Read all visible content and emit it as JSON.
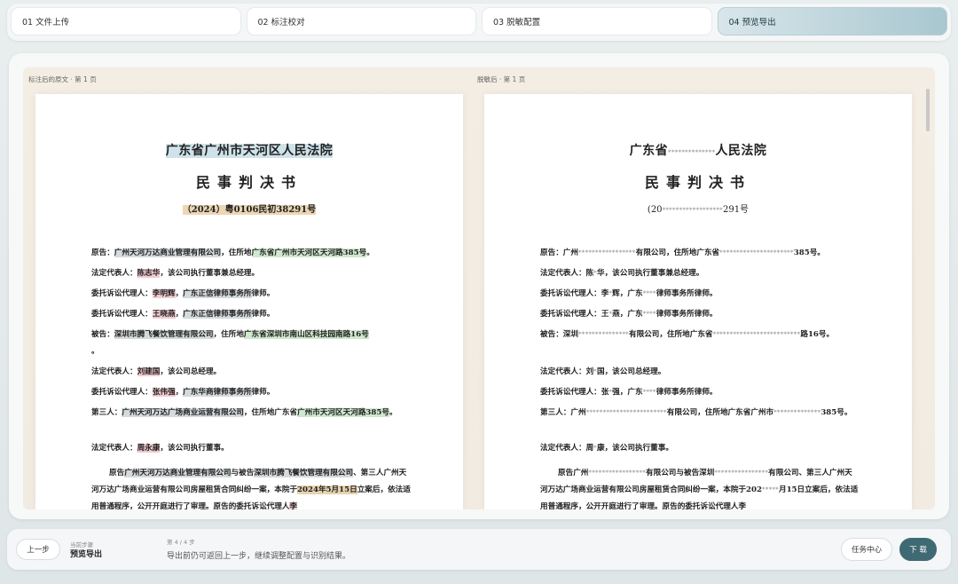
{
  "steps": [
    {
      "label": "01 文件上传"
    },
    {
      "label": "02 标注校对"
    },
    {
      "label": "03 脱敏配置"
    },
    {
      "label": "04 预览导出"
    }
  ],
  "left_pane": {
    "label": "标注后的原文 · 第 1 页",
    "court": "广东省广州市天河区人民法院",
    "doc_title": "民事判决书",
    "case_no": "（2024）粤0106民初38291号",
    "p1": {
      "a": "原告：",
      "org": "广州天河万达商业管理有限公司",
      "b": "，住所地",
      "addr": "广东省广州市天河区天河路385号",
      "c": "。"
    },
    "p2": {
      "a": "法定代表人：",
      "name": "陈志华",
      "b": "，该公司执行董事兼总经理。"
    },
    "p3": {
      "a": "委托诉讼代理人：",
      "name": "李明辉",
      "b": "，",
      "org": "广东正信律师事务所",
      "c": "律师。"
    },
    "p4": {
      "a": "委托诉讼代理人：",
      "name": "王晓燕",
      "b": "，",
      "org": "广东正信律师事务所",
      "c": "律师。"
    },
    "p5": {
      "a": "被告：",
      "org": "深圳市腾飞餐饮管理有限公司",
      "b": "，住所地",
      "addr": "广东省深圳市南山区科技园南路16号",
      "c": "。"
    },
    "p6": {
      "a": "法定代表人：",
      "name": "刘建国",
      "b": "，该公司总经理。"
    },
    "p7": {
      "a": "委托诉讼代理人：",
      "name": "张伟强",
      "b": "，",
      "org": "广东华商律师事务所",
      "c": "律师。"
    },
    "p8": {
      "a": "第三人：",
      "org": "广州天河万达广场商业运营有限公司",
      "b": "，住所地广东省",
      "addr": "广州市天河区天河路385号",
      "c": "。"
    },
    "p9": {
      "a": "法定代表人：",
      "name": "周永康",
      "b": "，该公司执行董事。"
    },
    "p10": {
      "a": "原告",
      "org1": "广州天河万达商业管理有限公司",
      "b": "与被告",
      "org2": "深圳市腾飞餐饮管理有限公司",
      "c": "、第三人广州天河万达广场商业运营有限公司房屋租赁合同纠纷一案，本院于",
      "date": "2024年5月15日",
      "d": "立案后，依法适用普通程序，公开开庭进行了审理。原告的委托诉讼代理人",
      "name": "李"
    }
  },
  "right_pane": {
    "label": "脱敏后 · 第 1 页",
    "court_a": "广东省",
    "court_mask": "**************",
    "court_b": "人民法院",
    "doc_title": "民事判决书",
    "case_a": "(20",
    "case_mask": "******************",
    "case_b": "291号",
    "p1": {
      "a": "原告：广州",
      "m1": "*****************",
      "b": "有限公司，住所地广东省",
      "m2": "**********************",
      "c": "385号。"
    },
    "p2": {
      "a": "法定代表人：陈",
      "m": "*",
      "b": "华，该公司执行董事兼总经理。"
    },
    "p3": {
      "a": "委托诉讼代理人：李",
      "m1": "*",
      "b": "辉，广东",
      "m2": "****",
      "c": "律师事务所律师。"
    },
    "p4": {
      "a": "委托诉讼代理人：王",
      "m1": "*",
      "b": "燕，广东",
      "m2": "****",
      "c": "律师事务所律师。"
    },
    "p5": {
      "a": "被告：深圳",
      "m1": "***************",
      "b": "有限公司，住所地广东省",
      "m2": "**************************",
      "c": "路16号。"
    },
    "p6": {
      "a": "法定代表人：刘",
      "m": "*",
      "b": "国，该公司总经理。"
    },
    "p7": {
      "a": "委托诉讼代理人：张",
      "m1": "*",
      "b": "强，广东",
      "m2": "****",
      "c": "律师事务所律师。"
    },
    "p8": {
      "a": "第三人：广州",
      "m1": "************************",
      "b": "有限公司，住所地广东省广州市",
      "m2": "**************",
      "c": "385号。"
    },
    "p9": {
      "a": "法定代表人：周",
      "m": "*",
      "b": "康，该公司执行董事。"
    },
    "p10": {
      "a": "原告广州",
      "m1": "*****************",
      "b": "有限公司与被告深圳",
      "m2": "****************",
      "c": "有限公司、第三人广州天河万达广场商业运营有限公司房屋租赁合同纠纷一案，本院于202",
      "m3": "*****",
      "d": "月15日立案后，依法适用普通程序，公开开庭进行了审理。原告的委托诉讼代理人李"
    }
  },
  "bottom": {
    "prev_label": "上一步",
    "current_step_caption": "当前步骤",
    "current_step_name": "预览导出",
    "step_count": "第 4 / 4 步",
    "hint": "导出前仍可返回上一步，继续调整配置与识别结果。",
    "task_center_label": "任务中心",
    "next_label": "下 载"
  }
}
